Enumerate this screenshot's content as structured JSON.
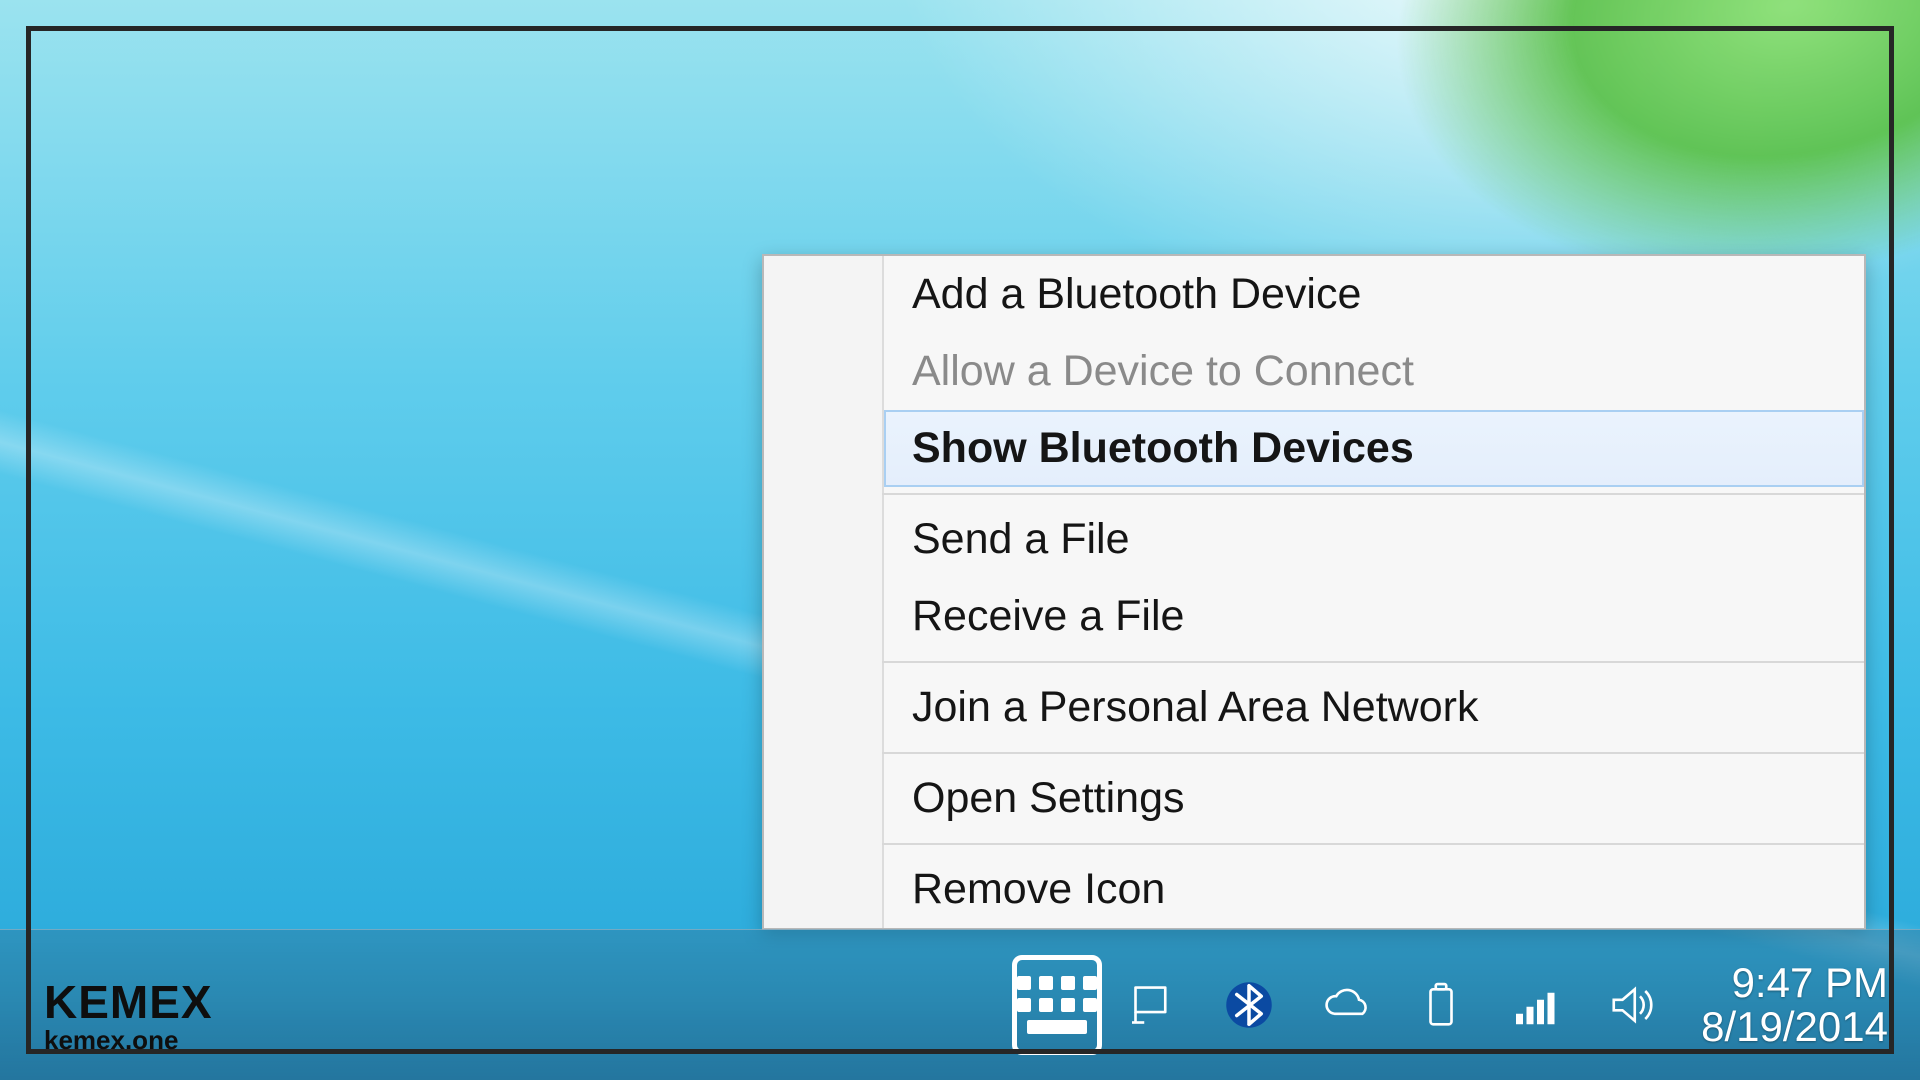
{
  "menu": {
    "items": [
      {
        "label": "Add a Bluetooth Device",
        "disabled": false
      },
      {
        "label": "Allow a Device to Connect",
        "disabled": true
      },
      {
        "label": "Show Bluetooth Devices",
        "disabled": false,
        "hovered": true
      },
      {
        "label": "Send a File",
        "disabled": false
      },
      {
        "label": "Receive a File",
        "disabled": false
      },
      {
        "label": "Join a Personal Area Network",
        "disabled": false
      },
      {
        "label": "Open Settings",
        "disabled": false
      },
      {
        "label": "Remove Icon",
        "disabled": false
      }
    ]
  },
  "tray": {
    "icons": {
      "keyboard": "keyboard-icon",
      "flag": "action-center-icon",
      "bluetooth": "bluetooth-icon",
      "cloud": "onedrive-icon",
      "battery": "battery-icon",
      "network": "network-signal-icon",
      "volume": "volume-icon"
    },
    "time": "9:47 PM",
    "date": "8/19/2014"
  },
  "watermark": {
    "brand": "KEMEX",
    "site": "kemex.one"
  }
}
